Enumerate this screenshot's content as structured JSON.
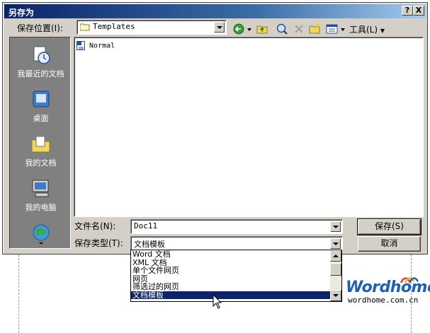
{
  "window": {
    "title": "另存为",
    "help_btn": "?",
    "close_btn": "X"
  },
  "save_in": {
    "label": "保存位置(I):",
    "value": "Templates"
  },
  "toolbar": {
    "tools_label": "工具(L)"
  },
  "places": [
    {
      "label": "我最近的文档",
      "icon": "recent-docs-icon"
    },
    {
      "label": "桌面",
      "icon": "desktop-icon"
    },
    {
      "label": "我的文档",
      "icon": "my-documents-icon"
    },
    {
      "label": "我的电脑",
      "icon": "my-computer-icon"
    },
    {
      "label": "",
      "icon": "network-places-icon"
    }
  ],
  "files": [
    {
      "name": "Normal",
      "icon": "word-document-icon"
    }
  ],
  "filename": {
    "label": "文件名(N):",
    "value": "Doc11"
  },
  "filetype": {
    "label": "保存类型(T):",
    "value": "文档模板",
    "options": [
      "Word 文档",
      "XML 文档",
      "单个文件网页",
      "网页",
      "筛选过的网页",
      "文档模板"
    ],
    "selected_index": 5
  },
  "buttons": {
    "save": "保存(S)",
    "cancel": "取消"
  },
  "branding": {
    "logo": "Wordhome",
    "url": "wordhome.com.cn"
  },
  "colors": {
    "titlebar": "#0a246a",
    "selection": "#0a246a",
    "dialog_face": "#d4d0c8",
    "places_bg": "#808080",
    "logo_blue": "#1f5fb5"
  }
}
